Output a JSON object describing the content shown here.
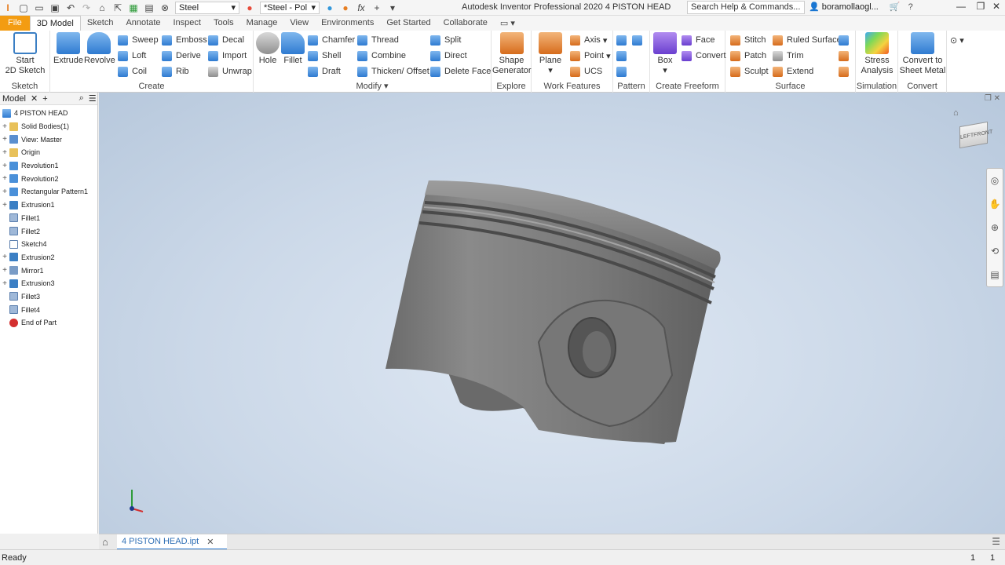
{
  "quick_access": {
    "material": "Steel",
    "appearance": "*Steel - Pol",
    "fx": "fx"
  },
  "title": "Autodesk Inventor Professional 2020   4 PISTON HEAD",
  "search": {
    "placeholder": "Search Help & Commands..."
  },
  "user": {
    "name": "boramollaogl..."
  },
  "tabs": [
    "File",
    "3D Model",
    "Sketch",
    "Annotate",
    "Inspect",
    "Tools",
    "Manage",
    "View",
    "Environments",
    "Get Started",
    "Collaborate"
  ],
  "ribbon": {
    "sketch_group": {
      "label": "Sketch",
      "start_line1": "Start",
      "start_line2": "2D Sketch"
    },
    "create_group": {
      "label": "Create",
      "extrude": "Extrude",
      "revolve": "Revolve",
      "sweep": "Sweep",
      "loft": "Loft",
      "coil": "Coil",
      "emboss": "Emboss",
      "derive": "Derive",
      "rib": "Rib",
      "decal": "Decal",
      "import": "Import",
      "unwrap": "Unwrap"
    },
    "modify_group": {
      "label": "Modify",
      "hole": "Hole",
      "fillet": "Fillet",
      "chamfer": "Chamfer",
      "shell": "Shell",
      "draft": "Draft",
      "thread": "Thread",
      "combine": "Combine",
      "thicken": "Thicken/ Offset",
      "split": "Split",
      "direct": "Direct",
      "delete_face": "Delete Face"
    },
    "explore_group": {
      "label": "Explore",
      "shape_line1": "Shape",
      "shape_line2": "Generator"
    },
    "work_group": {
      "label": "Work Features",
      "plane": "Plane",
      "axis": "Axis",
      "point": "Point",
      "ucs": "UCS"
    },
    "pattern_group": {
      "label": "Pattern"
    },
    "freeform_group": {
      "label": "Create Freeform",
      "box": "Box",
      "face": "Face",
      "convert": "Convert"
    },
    "surface_group": {
      "label": "Surface",
      "stitch": "Stitch",
      "patch": "Patch",
      "sculpt": "Sculpt",
      "ruled": "Ruled Surface",
      "trim": "Trim",
      "extend": "Extend"
    },
    "simulation_group": {
      "label": "Simulation",
      "stress_line1": "Stress",
      "stress_line2": "Analysis"
    },
    "convert_group": {
      "label": "Convert",
      "sheet_line1": "Convert to",
      "sheet_line2": "Sheet Metal"
    }
  },
  "browser": {
    "title": "Model",
    "root": "4 PISTON HEAD",
    "items": [
      {
        "label": "Solid Bodies(1)",
        "expandable": true,
        "icon": "folder-icon"
      },
      {
        "label": "View: Master",
        "expandable": true,
        "icon": "view-icon"
      },
      {
        "label": "Origin",
        "expandable": true,
        "icon": "folder-icon"
      },
      {
        "label": "Revolution1",
        "expandable": true,
        "icon": "revolve-icon"
      },
      {
        "label": "Revolution2",
        "expandable": true,
        "icon": "revolve-icon"
      },
      {
        "label": "Rectangular Pattern1",
        "expandable": true,
        "icon": "pattern-icon"
      },
      {
        "label": "Extrusion1",
        "expandable": true,
        "icon": "extrude-icon"
      },
      {
        "label": "Fillet1",
        "expandable": false,
        "icon": "fillet-icon"
      },
      {
        "label": "Fillet2",
        "expandable": false,
        "icon": "fillet-icon"
      },
      {
        "label": "Sketch4",
        "expandable": false,
        "icon": "sketch-icon"
      },
      {
        "label": "Extrusion2",
        "expandable": true,
        "icon": "extrude-icon"
      },
      {
        "label": "Mirror1",
        "expandable": true,
        "icon": "mirror-icon"
      },
      {
        "label": "Extrusion3",
        "expandable": true,
        "icon": "extrude-icon"
      },
      {
        "label": "Fillet3",
        "expandable": false,
        "icon": "fillet-icon"
      },
      {
        "label": "Fillet4",
        "expandable": false,
        "icon": "fillet-icon"
      },
      {
        "label": "End of Part",
        "expandable": false,
        "icon": "end-of-part-icon"
      }
    ]
  },
  "viewcube": {
    "left": "LEFT",
    "front": "FRONT"
  },
  "document_tab": {
    "label": "4 PISTON HEAD.ipt"
  },
  "status": {
    "text": "Ready",
    "count1": "1",
    "count2": "1"
  },
  "colors": {
    "file_tab": "#f39c12",
    "accent": "#2f7bd1",
    "piston": "#7d7d7d"
  }
}
